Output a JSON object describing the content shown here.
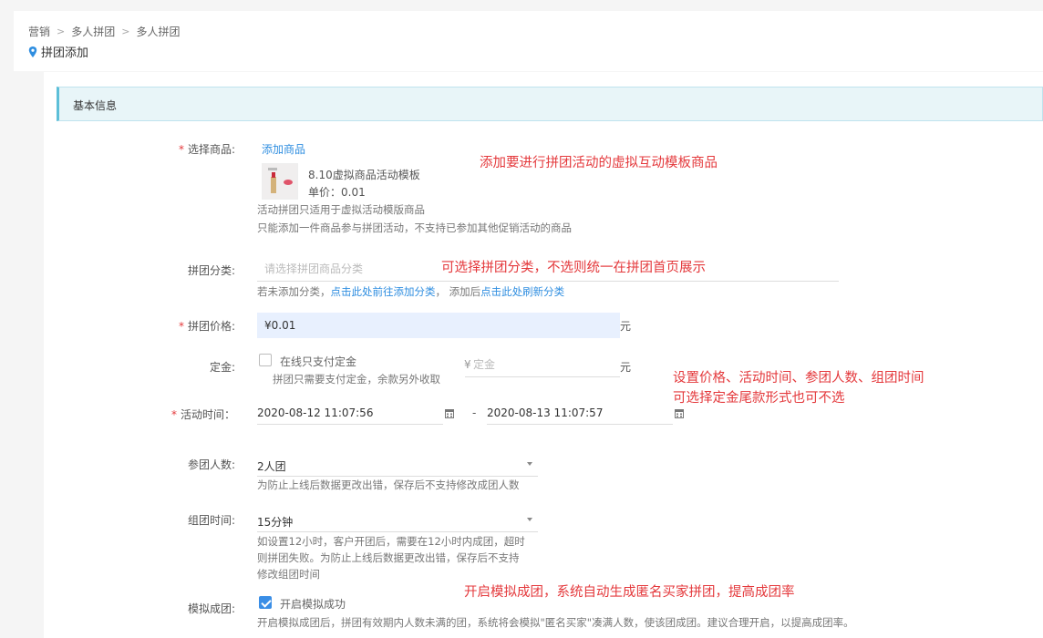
{
  "breadcrumb": [
    "营销",
    "多人拼团",
    "多人拼团"
  ],
  "page_title": "拼团添加",
  "section_title": "基本信息",
  "product": {
    "label": "选择商品:",
    "add_link": "添加商品",
    "name": "8.10虚拟商品活动模板",
    "price": "单价：0.01",
    "help1": "活动拼团只适用于虚拟活动模版商品",
    "help2": "只能添加一件商品参与拼团活动，不支持已参加其他促销活动的商品"
  },
  "category": {
    "label": "拼团分类:",
    "placeholder": "请选择拼团商品分类",
    "help_prefix": "若未添加分类，",
    "help_link1": "点击此处前往添加分类",
    "help_mid": "，  添加后",
    "help_link2": "点击此处刷新分类"
  },
  "price": {
    "label": "拼团价格:",
    "value": "¥0.01",
    "unit": "元"
  },
  "deposit": {
    "label": "定金:",
    "checkbox_label": "在线只支付定金",
    "help": "拼团只需要支付定金，余款另外收取",
    "placeholder": "定金",
    "currency": "¥",
    "unit": "元"
  },
  "activity_time": {
    "label": "活动时间：",
    "start": "2020-08-12 11:07:56",
    "separator": "-",
    "end": "2020-08-13 11:07:57"
  },
  "group_size": {
    "label": "参团人数:",
    "value": "2人团",
    "help": "为防止上线后数据更改出错，保存后不支持修改成团人数"
  },
  "group_time": {
    "label": "组团时间:",
    "value": "15分钟",
    "help1": "如设置12小时，客户开团后，需要在12小时内成团，超时",
    "help2": "则拼团失败。为防止上线后数据更改出错，保存后不支持",
    "help3": "修改组团时间"
  },
  "simulate": {
    "label": "模拟成团:",
    "checkbox_label": "开启模拟成功",
    "checked": true,
    "help": "开启模拟成团后，拼团有效期内人数未满的团，系统将会模拟\"匿名买家\"凑满人数，使该团成团。建议合理开启，以提高成团率。"
  },
  "notes": {
    "product": "添加要进行拼团活动的虚拟互动模板商品",
    "category": "可选择拼团分类，不选则统一在拼团首页展示",
    "settings1": "设置价格、活动时间、参团人数、组团时间",
    "settings2": "可选择定金尾款形式也可不选",
    "simulate": "开启模拟成团，系统自动生成匿名买家拼团，提高成团率"
  },
  "colors": {
    "required": "#e4393c",
    "link": "#2f8ee0",
    "accent": "#5dbfd8",
    "note": "#e4393c"
  }
}
